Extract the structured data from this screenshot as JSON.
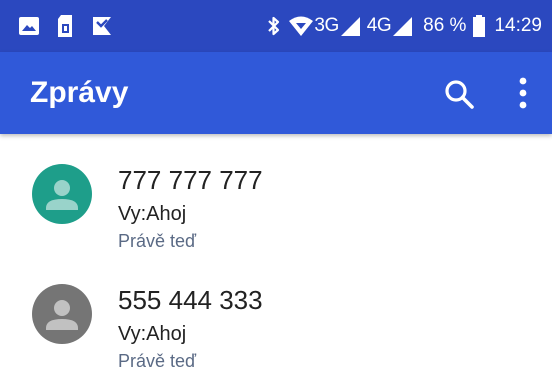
{
  "status_bar": {
    "network_3g": "3G",
    "network_4g": "4G",
    "battery_percent": "86 %",
    "time": "14:29",
    "icons": [
      "image-icon",
      "sim-card-icon",
      "missed-call-icon",
      "bluetooth-icon",
      "wifi-icon",
      "signal-icon",
      "battery-icon"
    ]
  },
  "app_bar": {
    "title": "Zprávy",
    "icons": [
      "search-icon",
      "more-vert-icon"
    ],
    "color": "#3059d9"
  },
  "conversations": [
    {
      "name": "777 777 777",
      "snippet": "Vy:Ahoj",
      "time": "Právě teď",
      "avatar_color": "#1e9e8a"
    },
    {
      "name": "555 444 333",
      "snippet": "Vy:Ahoj",
      "time": "Právě teď",
      "avatar_color": "#757575"
    }
  ]
}
